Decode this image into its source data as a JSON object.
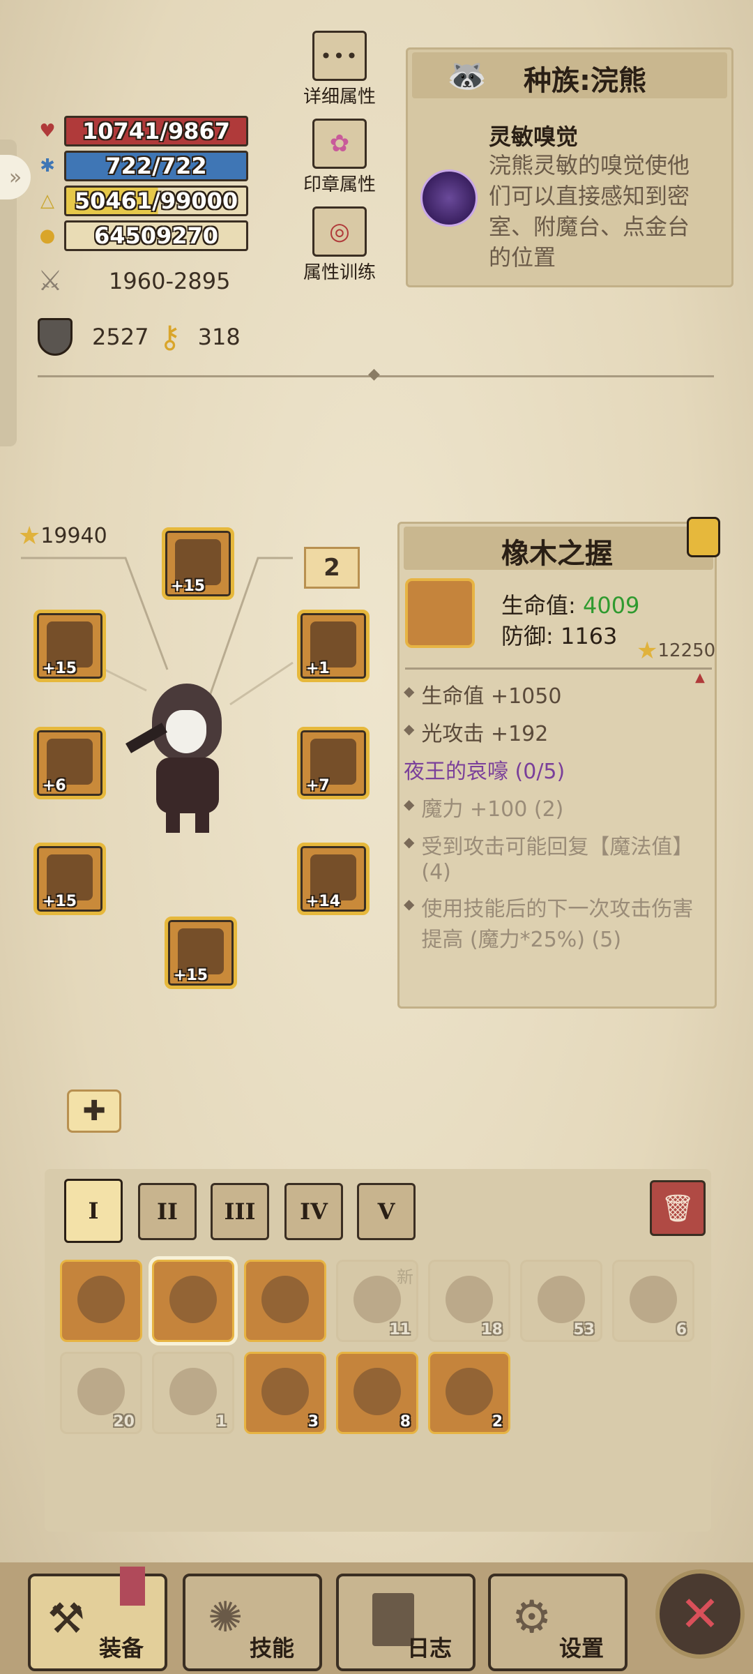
{
  "stats": {
    "hp": "10741/9867",
    "mp": "722/722",
    "exp": "50461/99000",
    "exp_ratio": 0.51,
    "gold": "64509270",
    "attack": "1960-2895",
    "defense": "2527",
    "keys": "318"
  },
  "menu": {
    "detail": "详细属性",
    "seal": "印章属性",
    "training": "属性训练"
  },
  "race": {
    "title": "种族:浣熊",
    "skill_name": "灵敏嗅觉",
    "skill_desc": "浣熊灵敏的嗅觉使他们可以直接感知到密室、附魔台、点金台的位置"
  },
  "equipment": {
    "score": "19940",
    "page": "2",
    "slots": [
      {
        "name": "helmet",
        "level": "+15"
      },
      {
        "name": "bracelet",
        "level": "+15"
      },
      {
        "name": "necklace",
        "level": "+1"
      },
      {
        "name": "weapon",
        "level": "+6"
      },
      {
        "name": "armor",
        "level": "+7"
      },
      {
        "name": "ring",
        "level": "+15"
      },
      {
        "name": "pants",
        "level": "+14"
      },
      {
        "name": "boots",
        "level": "+15"
      }
    ]
  },
  "item": {
    "name": "橡木之握",
    "hp_label": "生命值:",
    "hp_value": "4009",
    "def_label": "防御:",
    "def_value": "1163",
    "score": "12250",
    "attrs": [
      "生命值 +1050",
      "光攻击 +192"
    ],
    "set_name": "夜王的哀嚎 (0/5)",
    "set_bonuses": [
      "魔力 +100 (2)",
      "受到攻击可能回复【魔法值】(4)",
      "使用技能后的下一次攻击伤害提高 (魔力*25%) (5)"
    ]
  },
  "tabs": [
    "I",
    "II",
    "III",
    "IV",
    "V"
  ],
  "inventory": {
    "row1": [
      {
        "name": "oak-gauntlet-locked",
        "count": ""
      },
      {
        "name": "oak-gauntlet",
        "count": ""
      },
      {
        "name": "horned-bracer",
        "count": ""
      },
      {
        "name": "scroll",
        "count": "11",
        "badge": "新"
      },
      {
        "name": "pickaxe",
        "count": "18"
      },
      {
        "name": "eye-scroll",
        "count": "53"
      },
      {
        "name": "red-potion",
        "count": "6"
      }
    ],
    "row2": [
      {
        "name": "green-flask",
        "count": "20"
      },
      {
        "name": "red-flask",
        "count": "1"
      },
      {
        "name": "green-potion",
        "count": "3"
      },
      {
        "name": "yellow-potion",
        "count": "8"
      },
      {
        "name": "pink-potion",
        "count": "2"
      }
    ]
  },
  "nav": {
    "equip": "装备",
    "skills": "技能",
    "log": "日志",
    "settings": "设置"
  },
  "colors": {
    "hp": "#b03a3a",
    "mp": "#3f76b5",
    "exp": "#e6c84a",
    "green_value": "#2f9a2f",
    "set_purple": "#7a3f9a"
  }
}
